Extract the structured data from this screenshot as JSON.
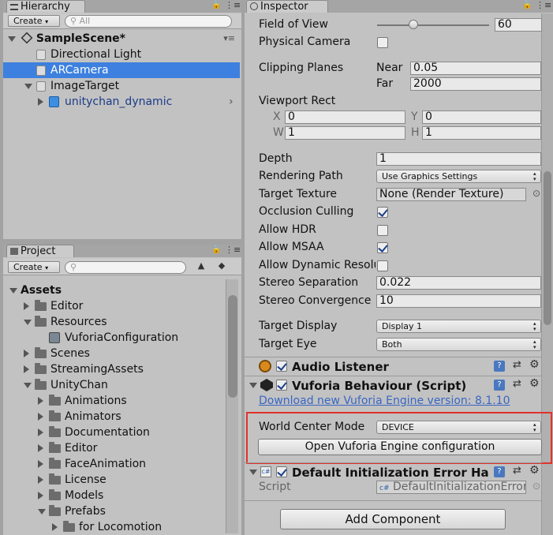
{
  "hierarchy": {
    "tab": "Hierarchy",
    "create": "Create",
    "search_placeholder": "All",
    "scene": "SampleScene*",
    "items": [
      "Directional Light",
      "ARCamera",
      "ImageTarget",
      "unitychan_dynamic"
    ]
  },
  "project": {
    "tab": "Project",
    "create": "Create",
    "tree": [
      "Assets",
      "Editor",
      "Resources",
      "VuforiaConfiguration",
      "Scenes",
      "StreamingAssets",
      "UnityChan",
      "Animations",
      "Animators",
      "Documentation",
      "Editor",
      "FaceAnimation",
      "License",
      "Models",
      "Prefabs",
      "for Locomotion"
    ]
  },
  "inspector": {
    "tab": "Inspector",
    "field_of_view": {
      "label": "Field of View",
      "value": "60",
      "slider": 0.31
    },
    "physical_camera": "Physical Camera",
    "clipping": {
      "label": "Clipping Planes",
      "near_label": "Near",
      "near": "0.05",
      "far_label": "Far",
      "far": "2000"
    },
    "viewport": {
      "label": "Viewport Rect",
      "x_label": "X",
      "x": "0",
      "y_label": "Y",
      "y": "0",
      "w_label": "W",
      "w": "1",
      "h_label": "H",
      "h": "1"
    },
    "depth": {
      "label": "Depth",
      "value": "1"
    },
    "rendering_path": {
      "label": "Rendering Path",
      "value": "Use Graphics Settings"
    },
    "target_texture": {
      "label": "Target Texture",
      "value": "None (Render Texture)"
    },
    "occlusion_culling": "Occlusion Culling",
    "allow_hdr": "Allow HDR",
    "allow_msaa": "Allow MSAA",
    "allow_dynamic": "Allow Dynamic Resolu",
    "stereo_separation": {
      "label": "Stereo Separation",
      "value": "0.022"
    },
    "stereo_convergence": {
      "label": "Stereo Convergence",
      "value": "10"
    },
    "target_display": {
      "label": "Target Display",
      "value": "Display 1"
    },
    "target_eye": {
      "label": "Target Eye",
      "value": "Both"
    },
    "audio_listener": "Audio Listener",
    "vuforia_behaviour": "Vuforia Behaviour (Script)",
    "download_link": "Download new Vuforia Engine version: 8.1.10",
    "world_center_mode": {
      "label": "World Center Mode",
      "value": "DEVICE"
    },
    "open_config": "Open Vuforia Engine configuration",
    "default_init": "Default Initialization Error Ha",
    "script": {
      "label": "Script",
      "value": "DefaultInitializationError"
    },
    "add_component": "Add Component"
  },
  "colors": {
    "selection": "#3d80df",
    "highlight_box": "#e0322c",
    "link": "#3a66c4"
  }
}
